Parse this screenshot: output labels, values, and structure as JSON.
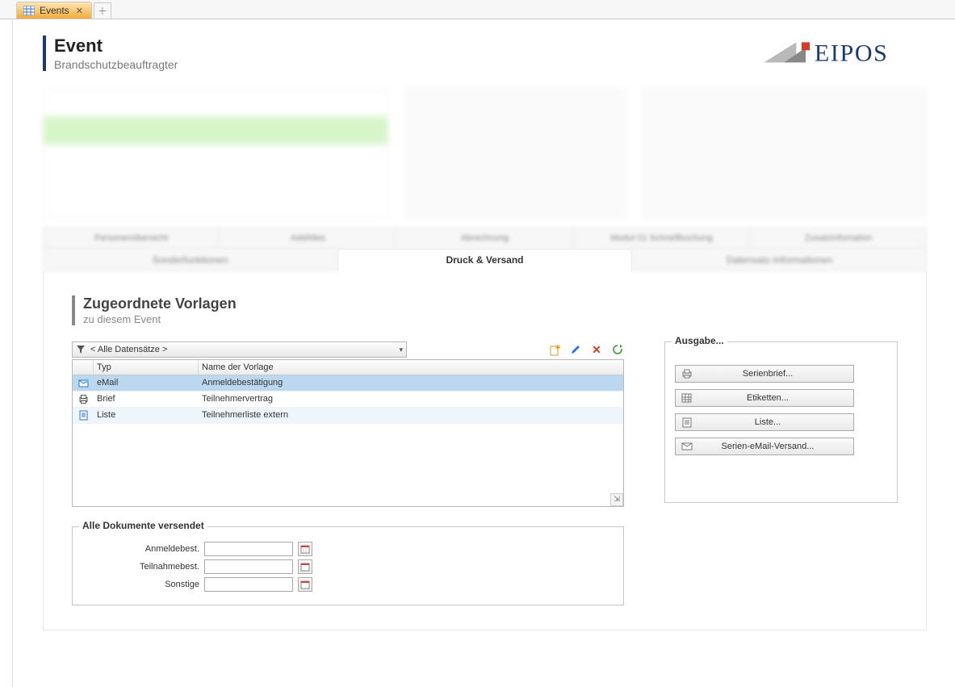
{
  "tabs": {
    "events": "Events"
  },
  "header": {
    "title": "Event",
    "subtitle": "Brandschutzbeauftragter"
  },
  "logo": {
    "text": "EIPOS"
  },
  "section_tabs_top": [
    "Personenübersicht",
    "AddAlles",
    "Abrechnung",
    "Modul 01 Schnellbuchung",
    "Zusatzinfomation"
  ],
  "section_tabs_bottom": {
    "a": "Sonderfunktionen",
    "b": "Druck & Versand",
    "c": "Datensatz-Informationen"
  },
  "sub_header": {
    "title": "Zugeordnete Vorlagen",
    "subtitle": "zu diesem Event"
  },
  "filter": {
    "placeholder": "< Alle Datensätze >"
  },
  "table": {
    "headers": {
      "icon": "",
      "type": "Typ",
      "name": "Name der Vorlage"
    },
    "rows": [
      {
        "icon": "mail",
        "type": "eMail",
        "name": "Anmeldebestätigung",
        "selected": true
      },
      {
        "icon": "print",
        "type": "Brief",
        "name": "Teilnehmervertrag"
      },
      {
        "icon": "list",
        "type": "Liste",
        "name": "Teilnehmerliste extern",
        "alt": true
      }
    ]
  },
  "output": {
    "legend": "Ausgabe...",
    "buttons": {
      "serienbrief": "Serienbrief...",
      "etiketten": "Etiketten...",
      "liste": "Liste...",
      "serien_email": "Serien-eMail-Versand..."
    }
  },
  "docs": {
    "legend": "Alle Dokumente versendet",
    "rows": {
      "anmelde": "Anmeldebest.",
      "teilnahme": "Teilnahmebest.",
      "sonstige": "Sonstige"
    }
  }
}
